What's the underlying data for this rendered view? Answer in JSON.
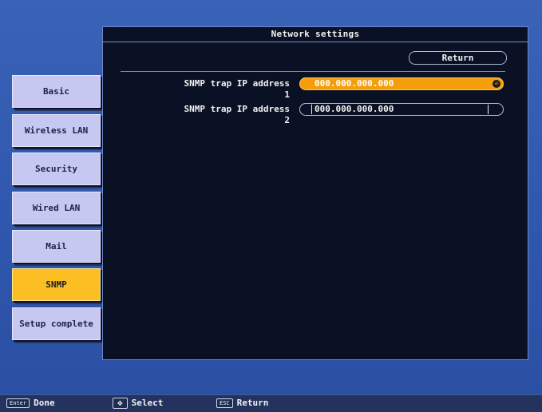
{
  "window": {
    "title": "Network settings"
  },
  "header": {
    "return_label": "Return"
  },
  "fields": [
    {
      "label": "SNMP trap IP address 1",
      "value": "000.000.000.000",
      "active": true
    },
    {
      "label": "SNMP trap IP address 2",
      "value": "000.000.000.000",
      "active": false
    }
  ],
  "menu": {
    "items": [
      {
        "label": "Basic"
      },
      {
        "label": "Wireless LAN"
      },
      {
        "label": "Security"
      },
      {
        "label": "Wired LAN"
      },
      {
        "label": "Mail"
      },
      {
        "label": "SNMP",
        "selected": true
      },
      {
        "label": "Setup complete"
      }
    ]
  },
  "footer": {
    "enter_key": "Enter",
    "enter_action": "Done",
    "select_key": "✥",
    "select_action": "Select",
    "esc_key": "ESC",
    "esc_action": "Return"
  },
  "colors": {
    "accent": "#f59e0b",
    "selected": "#fbbf24",
    "panel": "#0b1124",
    "background": "#3a63b8"
  }
}
